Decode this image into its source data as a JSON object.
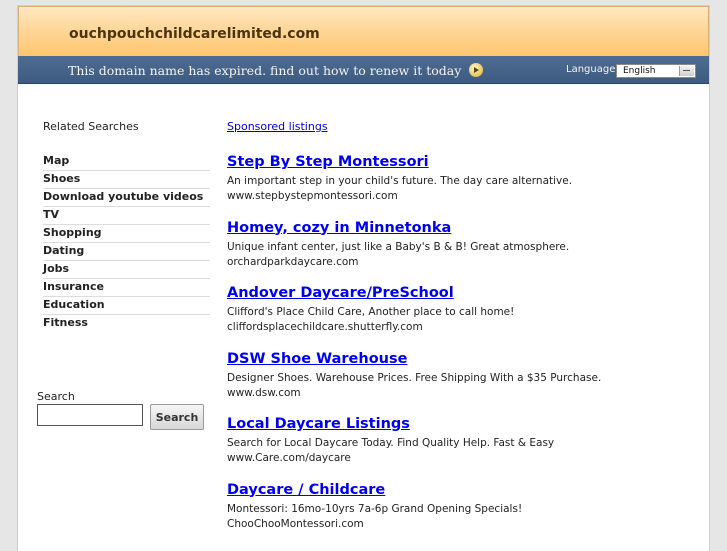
{
  "header": {
    "domain": "ouchpouchchildcarelimited.com",
    "expired_text": "This domain name has expired. find out how to renew it today",
    "language_label": "Language:",
    "language_value": "English"
  },
  "sidebar": {
    "related_title": "Related Searches",
    "items": [
      "Map",
      "Shoes",
      "Download youtube videos",
      "TV",
      "Shopping",
      "Dating",
      "Jobs",
      "Insurance",
      "Education",
      "Fitness"
    ],
    "search_label": "Search",
    "search_button": "Search",
    "search_value": ""
  },
  "main": {
    "sponsored_label": "Sponsored listings",
    "listings": [
      {
        "title": "Step By Step Montessori",
        "desc": "An important step in your child's future. The day care alternative.",
        "url": "www.stepbystepmontessori.com"
      },
      {
        "title": "Homey, cozy in Minnetonka",
        "desc": "Unique infant center, just like a Baby's B & B! Great atmosphere.",
        "url": "orchardparkdaycare.com"
      },
      {
        "title": "Andover Daycare/PreSchool",
        "desc": "Clifford's Place Child Care, Another place to call home!",
        "url": "cliffordsplacechildcare.shutterfly.com"
      },
      {
        "title": "DSW Shoe Warehouse",
        "desc": "Designer Shoes. Warehouse Prices. Free Shipping With a $35 Purchase.",
        "url": "www.dsw.com"
      },
      {
        "title": "Local Daycare Listings",
        "desc": "Search for Local Daycare Today. Find Quality Help. Fast & Easy",
        "url": "www.Care.com/daycare"
      },
      {
        "title": "Daycare / Childcare",
        "desc": "Montessori: 16mo-10yrs 7a-6p Grand Opening Specials!",
        "url": "ChooChooMontessori.com"
      }
    ]
  },
  "colors": {
    "header_gradient": "#ffd79a",
    "bar": "#3d5a80",
    "link": "#0000ee"
  }
}
